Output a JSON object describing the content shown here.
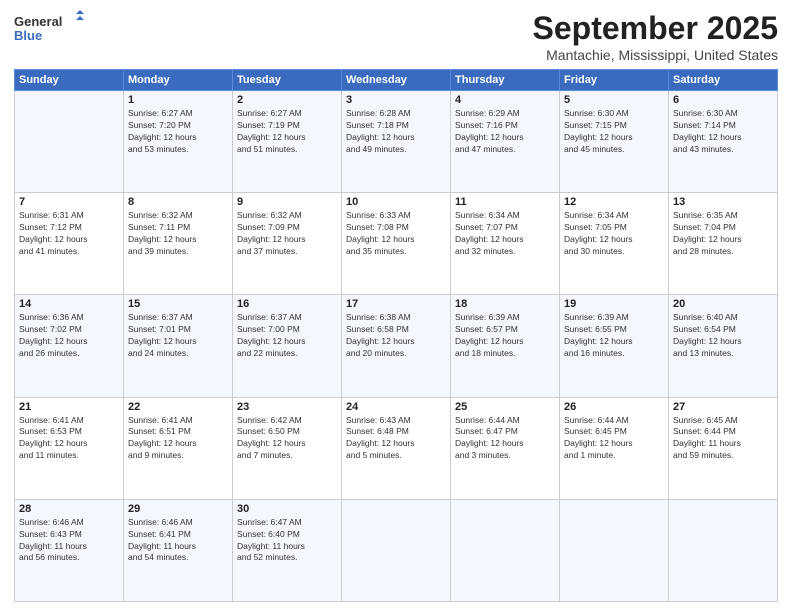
{
  "header": {
    "logo_line1": "General",
    "logo_line2": "Blue",
    "month": "September 2025",
    "location": "Mantachie, Mississippi, United States"
  },
  "weekdays": [
    "Sunday",
    "Monday",
    "Tuesday",
    "Wednesday",
    "Thursday",
    "Friday",
    "Saturday"
  ],
  "weeks": [
    [
      {
        "day": "",
        "info": ""
      },
      {
        "day": "1",
        "info": "Sunrise: 6:27 AM\nSunset: 7:20 PM\nDaylight: 12 hours\nand 53 minutes."
      },
      {
        "day": "2",
        "info": "Sunrise: 6:27 AM\nSunset: 7:19 PM\nDaylight: 12 hours\nand 51 minutes."
      },
      {
        "day": "3",
        "info": "Sunrise: 6:28 AM\nSunset: 7:18 PM\nDaylight: 12 hours\nand 49 minutes."
      },
      {
        "day": "4",
        "info": "Sunrise: 6:29 AM\nSunset: 7:16 PM\nDaylight: 12 hours\nand 47 minutes."
      },
      {
        "day": "5",
        "info": "Sunrise: 6:30 AM\nSunset: 7:15 PM\nDaylight: 12 hours\nand 45 minutes."
      },
      {
        "day": "6",
        "info": "Sunrise: 6:30 AM\nSunset: 7:14 PM\nDaylight: 12 hours\nand 43 minutes."
      }
    ],
    [
      {
        "day": "7",
        "info": "Sunrise: 6:31 AM\nSunset: 7:12 PM\nDaylight: 12 hours\nand 41 minutes."
      },
      {
        "day": "8",
        "info": "Sunrise: 6:32 AM\nSunset: 7:11 PM\nDaylight: 12 hours\nand 39 minutes."
      },
      {
        "day": "9",
        "info": "Sunrise: 6:32 AM\nSunset: 7:09 PM\nDaylight: 12 hours\nand 37 minutes."
      },
      {
        "day": "10",
        "info": "Sunrise: 6:33 AM\nSunset: 7:08 PM\nDaylight: 12 hours\nand 35 minutes."
      },
      {
        "day": "11",
        "info": "Sunrise: 6:34 AM\nSunset: 7:07 PM\nDaylight: 12 hours\nand 32 minutes."
      },
      {
        "day": "12",
        "info": "Sunrise: 6:34 AM\nSunset: 7:05 PM\nDaylight: 12 hours\nand 30 minutes."
      },
      {
        "day": "13",
        "info": "Sunrise: 6:35 AM\nSunset: 7:04 PM\nDaylight: 12 hours\nand 28 minutes."
      }
    ],
    [
      {
        "day": "14",
        "info": "Sunrise: 6:36 AM\nSunset: 7:02 PM\nDaylight: 12 hours\nand 26 minutes."
      },
      {
        "day": "15",
        "info": "Sunrise: 6:37 AM\nSunset: 7:01 PM\nDaylight: 12 hours\nand 24 minutes."
      },
      {
        "day": "16",
        "info": "Sunrise: 6:37 AM\nSunset: 7:00 PM\nDaylight: 12 hours\nand 22 minutes."
      },
      {
        "day": "17",
        "info": "Sunrise: 6:38 AM\nSunset: 6:58 PM\nDaylight: 12 hours\nand 20 minutes."
      },
      {
        "day": "18",
        "info": "Sunrise: 6:39 AM\nSunset: 6:57 PM\nDaylight: 12 hours\nand 18 minutes."
      },
      {
        "day": "19",
        "info": "Sunrise: 6:39 AM\nSunset: 6:55 PM\nDaylight: 12 hours\nand 16 minutes."
      },
      {
        "day": "20",
        "info": "Sunrise: 6:40 AM\nSunset: 6:54 PM\nDaylight: 12 hours\nand 13 minutes."
      }
    ],
    [
      {
        "day": "21",
        "info": "Sunrise: 6:41 AM\nSunset: 6:53 PM\nDaylight: 12 hours\nand 11 minutes."
      },
      {
        "day": "22",
        "info": "Sunrise: 6:41 AM\nSunset: 6:51 PM\nDaylight: 12 hours\nand 9 minutes."
      },
      {
        "day": "23",
        "info": "Sunrise: 6:42 AM\nSunset: 6:50 PM\nDaylight: 12 hours\nand 7 minutes."
      },
      {
        "day": "24",
        "info": "Sunrise: 6:43 AM\nSunset: 6:48 PM\nDaylight: 12 hours\nand 5 minutes."
      },
      {
        "day": "25",
        "info": "Sunrise: 6:44 AM\nSunset: 6:47 PM\nDaylight: 12 hours\nand 3 minutes."
      },
      {
        "day": "26",
        "info": "Sunrise: 6:44 AM\nSunset: 6:45 PM\nDaylight: 12 hours\nand 1 minute."
      },
      {
        "day": "27",
        "info": "Sunrise: 6:45 AM\nSunset: 6:44 PM\nDaylight: 11 hours\nand 59 minutes."
      }
    ],
    [
      {
        "day": "28",
        "info": "Sunrise: 6:46 AM\nSunset: 6:43 PM\nDaylight: 11 hours\nand 56 minutes."
      },
      {
        "day": "29",
        "info": "Sunrise: 6:46 AM\nSunset: 6:41 PM\nDaylight: 11 hours\nand 54 minutes."
      },
      {
        "day": "30",
        "info": "Sunrise: 6:47 AM\nSunset: 6:40 PM\nDaylight: 11 hours\nand 52 minutes."
      },
      {
        "day": "",
        "info": ""
      },
      {
        "day": "",
        "info": ""
      },
      {
        "day": "",
        "info": ""
      },
      {
        "day": "",
        "info": ""
      }
    ]
  ]
}
